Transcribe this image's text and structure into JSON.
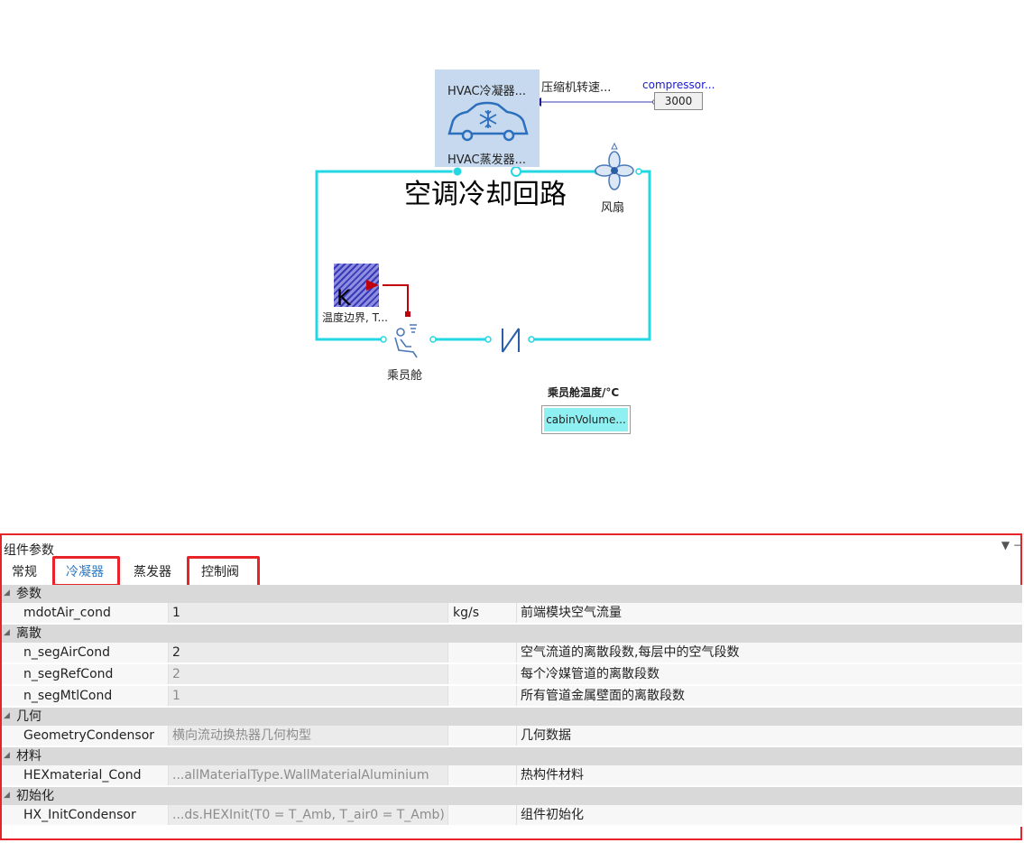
{
  "diagram": {
    "hvac_top_label": "HVAC冷凝器...",
    "hvac_bottom_label": "HVAC蒸发器...",
    "compressor_speed_label": "压缩机转速...",
    "compressor_source_label": "compressor...",
    "compressor_value": "3000",
    "loop_title": "空调冷却回路",
    "fan_label": "风扇",
    "temp_boundary_label": "温度边界, T...",
    "temp_boundary_letter": "K",
    "cabin_label": "乘员舱",
    "cabin_temp_title": "乘员舱温度/°C",
    "cabin_temp_display": "cabinVolume...",
    "colors": {
      "pipe": "#23d7e3",
      "signal": "#c0000a",
      "hvac_box": "#c6d9ee",
      "display_box": "#8ff0f2"
    }
  },
  "panel": {
    "title": "组件参数",
    "controls": "▼ −",
    "tabs": [
      "常规",
      "冷凝器",
      "蒸发器",
      "控制阀"
    ],
    "active_tab": "冷凝器",
    "groups": [
      {
        "name": "参数",
        "rows": [
          {
            "name": "mdotAir_cond",
            "value": "1",
            "unit": "kg/s",
            "desc": "前端模块空气流量",
            "dim": false
          }
        ]
      },
      {
        "name": "离散",
        "rows": [
          {
            "name": "n_segAirCond",
            "value": "2",
            "unit": "",
            "desc": "空气流道的离散段数,每层中的空气段数",
            "dim": false
          },
          {
            "name": "n_segRefCond",
            "value": "2",
            "unit": "",
            "desc": "每个冷媒管道的离散段数",
            "dim": true
          },
          {
            "name": "n_segMtlCond",
            "value": "1",
            "unit": "",
            "desc": "所有管道金属壁面的离散段数",
            "dim": true
          }
        ]
      },
      {
        "name": "几何",
        "rows": [
          {
            "name": "GeometryCondensor",
            "value": "横向流动换热器几何构型",
            "unit": "",
            "desc": "几何数据",
            "dim": true
          }
        ]
      },
      {
        "name": "材料",
        "rows": [
          {
            "name": "HEXmaterial_Cond",
            "value": "...allMaterialType.WallMaterialAluminium",
            "unit": "",
            "desc": "热构件材料",
            "dim": true
          }
        ]
      },
      {
        "name": "初始化",
        "rows": [
          {
            "name": "HX_InitCondensor",
            "value": "...ds.HEXInit(T0 = T_Amb, T_air0 = T_Amb)",
            "unit": "",
            "desc": "组件初始化",
            "dim": true
          }
        ]
      }
    ]
  }
}
